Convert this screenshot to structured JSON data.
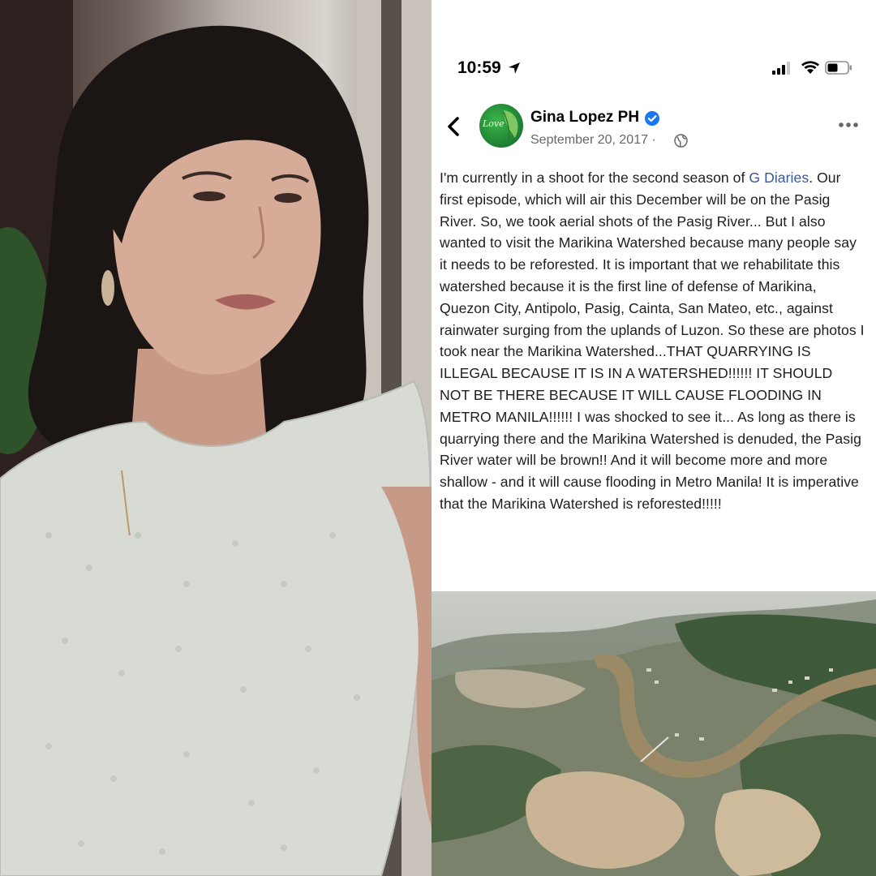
{
  "status_bar": {
    "time": "10:59",
    "icons": [
      "location-arrow-icon",
      "signal-icon",
      "wifi-icon",
      "battery-icon"
    ]
  },
  "post": {
    "page_name": "Gina Lopez PH",
    "verified": true,
    "avatar_text": "Love",
    "date": "September 20, 2017 ·",
    "audience_icon": "globe-icon",
    "body_before_link": "I'm currently in a shoot for the second season of ",
    "link_text": "G Diaries",
    "body_after_link": ". Our first episode, which will air this December will be on the Pasig River. So, we took aerial shots of the Pasig River... But I also wanted to visit the Marikina Watershed because many people say it needs to be reforested. It is important that we rehabilitate this watershed because it is the first line of defense of Marikina, Quezon City, Antipolo, Pasig, Cainta, San Mateo, etc., against rainwater surging from the uplands of Luzon. So these are photos I took near the Marikina Watershed...THAT QUARRYING IS ILLEGAL BECAUSE IT IS IN A WATERSHED!!!!!! IT SHOULD NOT BE THERE BECAUSE IT WILL CAUSE FLOODING IN METRO MANILA!!!!!! I was shocked to see it... As long as there is quarrying there and the Marikina Watershed is denuded, the Pasig River water will be brown!! And it will become more and more shallow - and it will cause flooding in Metro Manila! It is imperative that the Marikina Watershed is reforested!!!!!"
  },
  "colors": {
    "link": "#385898",
    "verified": "#1877f2",
    "meta_text": "#65676b",
    "body_text": "#1c1e21",
    "river": "#9c8a66"
  }
}
